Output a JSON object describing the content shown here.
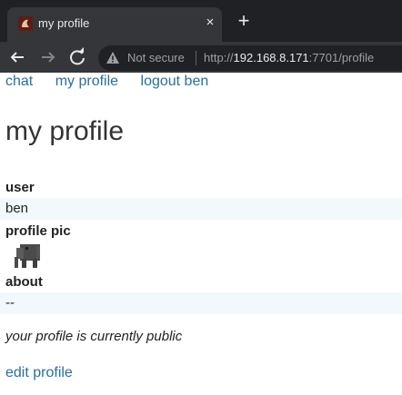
{
  "browser": {
    "tab_title": "my profile",
    "tab_close": "×",
    "new_tab": "+",
    "security_label": "Not secure",
    "url_scheme": "http://",
    "url_host": "192.168.8.171",
    "url_rest": ":7701/profile"
  },
  "nav": {
    "links": [
      "chat",
      "my profile",
      "logout ben"
    ]
  },
  "page": {
    "title": "my profile",
    "user_label": "user",
    "user_value": "ben",
    "pic_label": "profile pic",
    "about_label": "about",
    "about_value": "--",
    "public_note": "your profile is currently public",
    "edit_link": "edit profile"
  },
  "colors": {
    "link": "#2a6f9a",
    "row_background": "#f2f8fb",
    "chrome_dark": "#202124",
    "chrome_tab": "#35363a"
  }
}
